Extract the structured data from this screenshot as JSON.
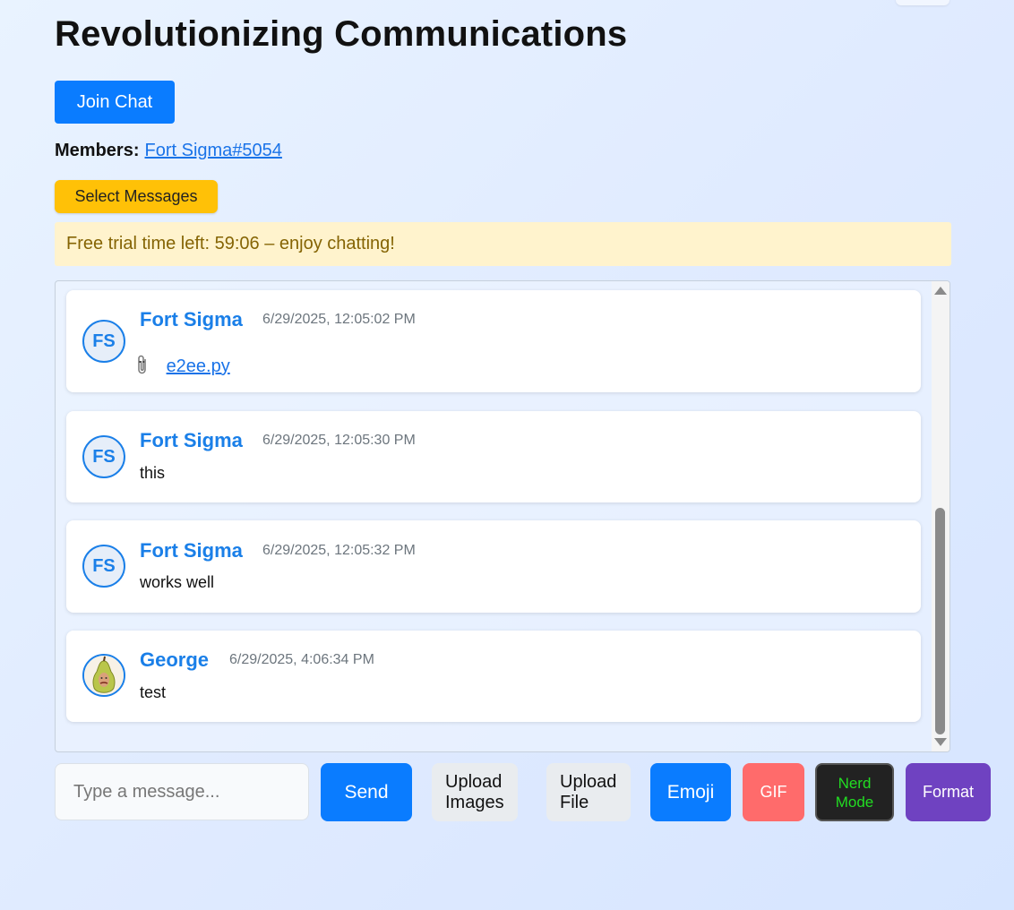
{
  "page_title": "Revolutionizing Communications",
  "join_button": "Join Chat",
  "members": {
    "label": "Members:",
    "link": "Fort Sigma#5054"
  },
  "select_button": "Select Messages",
  "trial_banner": "Free trial time left: 59:06 – enjoy chatting!",
  "messages": [
    {
      "initials": "FS",
      "name": "Fort Sigma",
      "time": "6/29/2025, 12:05:02 PM",
      "attachment_icon": "paperclip-icon",
      "file": "e2ee.py"
    },
    {
      "initials": "FS",
      "name": "Fort Sigma",
      "time": "6/29/2025, 12:05:30 PM",
      "text": "this"
    },
    {
      "initials": "FS",
      "name": "Fort Sigma",
      "time": "6/29/2025, 12:05:32 PM",
      "text": "works well"
    },
    {
      "avatar_icon": "pear-face-avatar",
      "name": "George",
      "time": "6/29/2025, 4:06:34 PM",
      "text": "test"
    }
  ],
  "composer": {
    "placeholder": "Type a message...",
    "send": "Send",
    "upload_images": "Upload Images",
    "upload_file": "Upload File",
    "emoji": "Emoji",
    "gif": "GIF",
    "nerd_mode": "Nerd Mode",
    "format": "Format"
  },
  "colors": {
    "accent": "#0a7cff",
    "name": "#1a7fe8",
    "warning": "#ffc107",
    "gif": "#ff6b6b",
    "format": "#6f42c1",
    "nerd_text": "#22dd22"
  }
}
